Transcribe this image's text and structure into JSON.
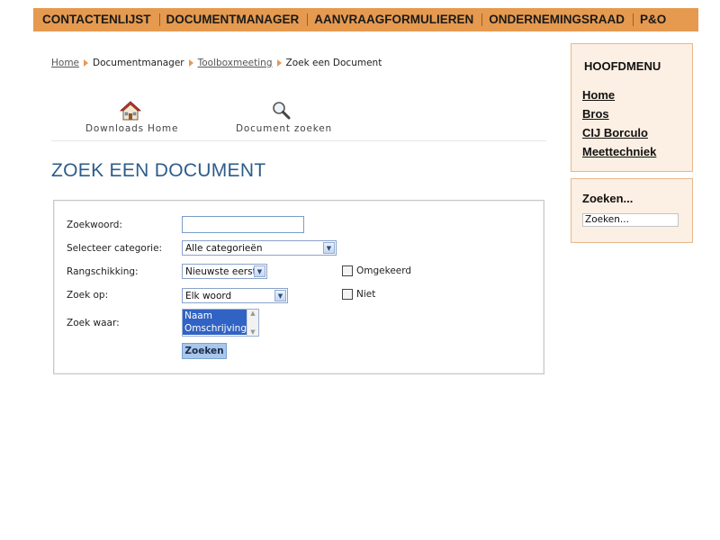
{
  "topnav": {
    "items": [
      "CONTACTENLIJST",
      "DOCUMENTMANAGER",
      "AANVRAAGFORMULIEREN",
      "ONDERNEMINGSRAAD",
      "P&O"
    ]
  },
  "breadcrumb": {
    "items": [
      "Home",
      "Documentmanager",
      "Toolboxmeeting",
      "Zoek een Document"
    ]
  },
  "toolbar": {
    "home_label": "Downloads Home",
    "search_label": "Document zoeken",
    "home_icon": "house-icon",
    "search_icon": "magnifier-icon"
  },
  "page": {
    "title": "ZOEK EEN DOCUMENT"
  },
  "form": {
    "keyword_label": "Zoekwoord:",
    "keyword_value": "",
    "category_label": "Selecteer categorie:",
    "category_value": "Alle categorieën",
    "order_label": "Rangschikking:",
    "order_value": "Nieuwste eerst",
    "reversed_label": "Omgekeerd",
    "search_on_label": "Zoek op:",
    "search_on_value": "Elk woord",
    "not_label": "Niet",
    "search_where_label": "Zoek waar:",
    "search_where_options": [
      "Naam",
      "Omschrijving"
    ],
    "submit_label": "Zoeken"
  },
  "sidebar": {
    "menu_title": "HOOFDMENU",
    "menu_items": [
      "Home",
      "Bros",
      "CIJ Borculo",
      "Meettechniek"
    ],
    "search_title": "Zoeken...",
    "search_value": "Zoeken..."
  },
  "colors": {
    "nav_bg": "#e59a4f",
    "title_blue": "#2d5c8a",
    "sidebar_bg": "#fcefe3",
    "sidebar_border": "#e8b88a",
    "listbox_selected": "#3163c4",
    "button_bg": "#a8c7ea"
  }
}
